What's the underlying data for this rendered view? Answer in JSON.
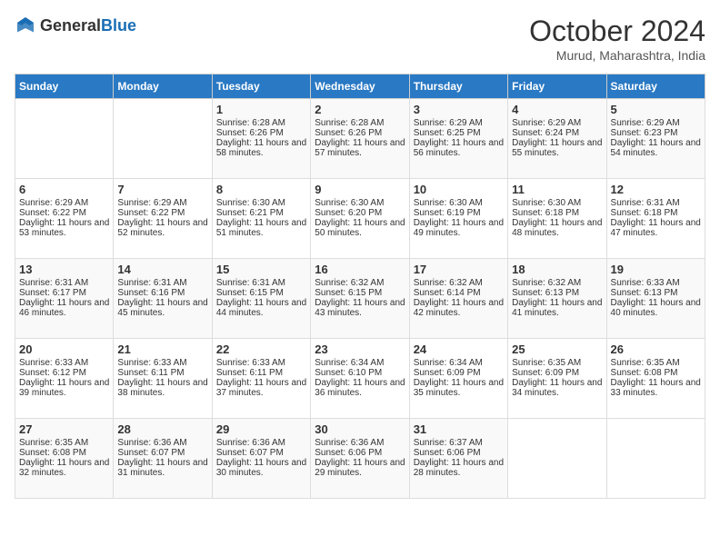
{
  "header": {
    "logo_general": "General",
    "logo_blue": "Blue",
    "month_year": "October 2024",
    "location": "Murud, Maharashtra, India"
  },
  "days_of_week": [
    "Sunday",
    "Monday",
    "Tuesday",
    "Wednesday",
    "Thursday",
    "Friday",
    "Saturday"
  ],
  "weeks": [
    [
      {
        "day": "",
        "sunrise": "",
        "sunset": "",
        "daylight": ""
      },
      {
        "day": "",
        "sunrise": "",
        "sunset": "",
        "daylight": ""
      },
      {
        "day": "1",
        "sunrise": "Sunrise: 6:28 AM",
        "sunset": "Sunset: 6:26 PM",
        "daylight": "Daylight: 11 hours and 58 minutes."
      },
      {
        "day": "2",
        "sunrise": "Sunrise: 6:28 AM",
        "sunset": "Sunset: 6:26 PM",
        "daylight": "Daylight: 11 hours and 57 minutes."
      },
      {
        "day": "3",
        "sunrise": "Sunrise: 6:29 AM",
        "sunset": "Sunset: 6:25 PM",
        "daylight": "Daylight: 11 hours and 56 minutes."
      },
      {
        "day": "4",
        "sunrise": "Sunrise: 6:29 AM",
        "sunset": "Sunset: 6:24 PM",
        "daylight": "Daylight: 11 hours and 55 minutes."
      },
      {
        "day": "5",
        "sunrise": "Sunrise: 6:29 AM",
        "sunset": "Sunset: 6:23 PM",
        "daylight": "Daylight: 11 hours and 54 minutes."
      }
    ],
    [
      {
        "day": "6",
        "sunrise": "Sunrise: 6:29 AM",
        "sunset": "Sunset: 6:22 PM",
        "daylight": "Daylight: 11 hours and 53 minutes."
      },
      {
        "day": "7",
        "sunrise": "Sunrise: 6:29 AM",
        "sunset": "Sunset: 6:22 PM",
        "daylight": "Daylight: 11 hours and 52 minutes."
      },
      {
        "day": "8",
        "sunrise": "Sunrise: 6:30 AM",
        "sunset": "Sunset: 6:21 PM",
        "daylight": "Daylight: 11 hours and 51 minutes."
      },
      {
        "day": "9",
        "sunrise": "Sunrise: 6:30 AM",
        "sunset": "Sunset: 6:20 PM",
        "daylight": "Daylight: 11 hours and 50 minutes."
      },
      {
        "day": "10",
        "sunrise": "Sunrise: 6:30 AM",
        "sunset": "Sunset: 6:19 PM",
        "daylight": "Daylight: 11 hours and 49 minutes."
      },
      {
        "day": "11",
        "sunrise": "Sunrise: 6:30 AM",
        "sunset": "Sunset: 6:18 PM",
        "daylight": "Daylight: 11 hours and 48 minutes."
      },
      {
        "day": "12",
        "sunrise": "Sunrise: 6:31 AM",
        "sunset": "Sunset: 6:18 PM",
        "daylight": "Daylight: 11 hours and 47 minutes."
      }
    ],
    [
      {
        "day": "13",
        "sunrise": "Sunrise: 6:31 AM",
        "sunset": "Sunset: 6:17 PM",
        "daylight": "Daylight: 11 hours and 46 minutes."
      },
      {
        "day": "14",
        "sunrise": "Sunrise: 6:31 AM",
        "sunset": "Sunset: 6:16 PM",
        "daylight": "Daylight: 11 hours and 45 minutes."
      },
      {
        "day": "15",
        "sunrise": "Sunrise: 6:31 AM",
        "sunset": "Sunset: 6:15 PM",
        "daylight": "Daylight: 11 hours and 44 minutes."
      },
      {
        "day": "16",
        "sunrise": "Sunrise: 6:32 AM",
        "sunset": "Sunset: 6:15 PM",
        "daylight": "Daylight: 11 hours and 43 minutes."
      },
      {
        "day": "17",
        "sunrise": "Sunrise: 6:32 AM",
        "sunset": "Sunset: 6:14 PM",
        "daylight": "Daylight: 11 hours and 42 minutes."
      },
      {
        "day": "18",
        "sunrise": "Sunrise: 6:32 AM",
        "sunset": "Sunset: 6:13 PM",
        "daylight": "Daylight: 11 hours and 41 minutes."
      },
      {
        "day": "19",
        "sunrise": "Sunrise: 6:33 AM",
        "sunset": "Sunset: 6:13 PM",
        "daylight": "Daylight: 11 hours and 40 minutes."
      }
    ],
    [
      {
        "day": "20",
        "sunrise": "Sunrise: 6:33 AM",
        "sunset": "Sunset: 6:12 PM",
        "daylight": "Daylight: 11 hours and 39 minutes."
      },
      {
        "day": "21",
        "sunrise": "Sunrise: 6:33 AM",
        "sunset": "Sunset: 6:11 PM",
        "daylight": "Daylight: 11 hours and 38 minutes."
      },
      {
        "day": "22",
        "sunrise": "Sunrise: 6:33 AM",
        "sunset": "Sunset: 6:11 PM",
        "daylight": "Daylight: 11 hours and 37 minutes."
      },
      {
        "day": "23",
        "sunrise": "Sunrise: 6:34 AM",
        "sunset": "Sunset: 6:10 PM",
        "daylight": "Daylight: 11 hours and 36 minutes."
      },
      {
        "day": "24",
        "sunrise": "Sunrise: 6:34 AM",
        "sunset": "Sunset: 6:09 PM",
        "daylight": "Daylight: 11 hours and 35 minutes."
      },
      {
        "day": "25",
        "sunrise": "Sunrise: 6:35 AM",
        "sunset": "Sunset: 6:09 PM",
        "daylight": "Daylight: 11 hours and 34 minutes."
      },
      {
        "day": "26",
        "sunrise": "Sunrise: 6:35 AM",
        "sunset": "Sunset: 6:08 PM",
        "daylight": "Daylight: 11 hours and 33 minutes."
      }
    ],
    [
      {
        "day": "27",
        "sunrise": "Sunrise: 6:35 AM",
        "sunset": "Sunset: 6:08 PM",
        "daylight": "Daylight: 11 hours and 32 minutes."
      },
      {
        "day": "28",
        "sunrise": "Sunrise: 6:36 AM",
        "sunset": "Sunset: 6:07 PM",
        "daylight": "Daylight: 11 hours and 31 minutes."
      },
      {
        "day": "29",
        "sunrise": "Sunrise: 6:36 AM",
        "sunset": "Sunset: 6:07 PM",
        "daylight": "Daylight: 11 hours and 30 minutes."
      },
      {
        "day": "30",
        "sunrise": "Sunrise: 6:36 AM",
        "sunset": "Sunset: 6:06 PM",
        "daylight": "Daylight: 11 hours and 29 minutes."
      },
      {
        "day": "31",
        "sunrise": "Sunrise: 6:37 AM",
        "sunset": "Sunset: 6:06 PM",
        "daylight": "Daylight: 11 hours and 28 minutes."
      },
      {
        "day": "",
        "sunrise": "",
        "sunset": "",
        "daylight": ""
      },
      {
        "day": "",
        "sunrise": "",
        "sunset": "",
        "daylight": ""
      }
    ]
  ]
}
